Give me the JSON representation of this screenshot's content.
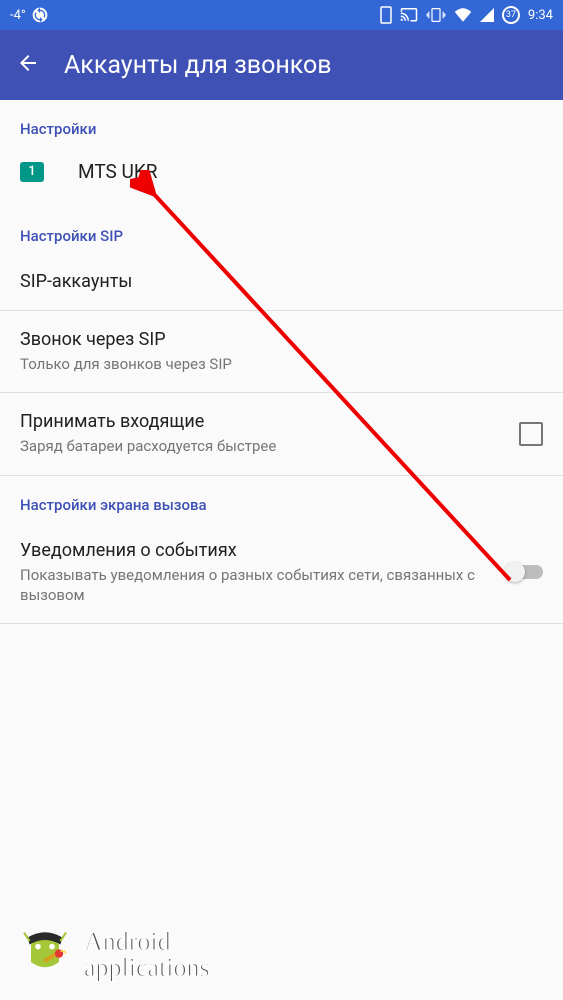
{
  "status": {
    "temp": "-4°",
    "battery": "37",
    "time": "9:34"
  },
  "appbar": {
    "title": "Аккаунты для звонков"
  },
  "sections": {
    "settings_header": "Настройки",
    "sim": {
      "number": "1",
      "label": "MTS UKR"
    },
    "sip_header": "Настройки SIP",
    "sip_accounts": {
      "title": "SIP-аккаунты"
    },
    "sip_call": {
      "title": "Звонок через SIP",
      "sub": "Только для звонков через SIP"
    },
    "incoming": {
      "title": "Принимать входящие",
      "sub": "Заряд батареи расходуется быстрее"
    },
    "call_screen_header": "Настройки экрана вызова",
    "notifications": {
      "title": "Уведомления о событиях",
      "sub": "Показывать уведомления о разных событиях сети, связанных с вызовом"
    }
  },
  "watermark": {
    "line1": "Android",
    "line2": "applications"
  }
}
